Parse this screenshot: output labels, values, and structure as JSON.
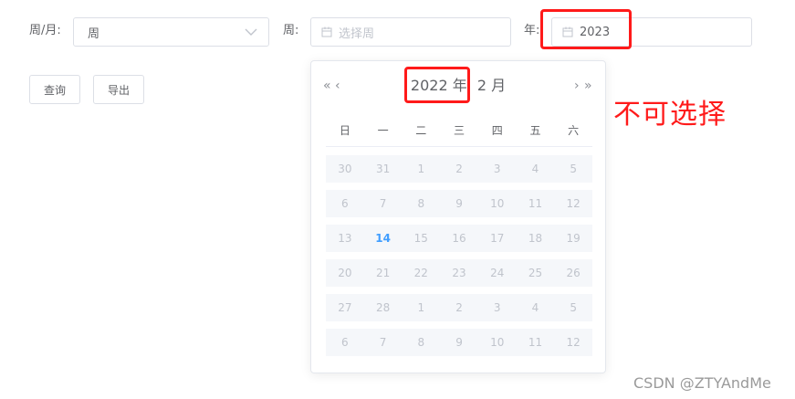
{
  "form": {
    "period_label": "周/月:",
    "period_value": "周",
    "week_label": "周:",
    "week_placeholder": "选择周",
    "year_label": "年:",
    "year_value": "2023"
  },
  "buttons": {
    "query": "查询",
    "export": "导出"
  },
  "picker": {
    "year_text": "2022 年",
    "month_text": "2 月",
    "weekdays": [
      "日",
      "一",
      "二",
      "三",
      "四",
      "五",
      "六"
    ],
    "rows": [
      [
        "30",
        "31",
        "1",
        "2",
        "3",
        "4",
        "5"
      ],
      [
        "6",
        "7",
        "8",
        "9",
        "10",
        "11",
        "12"
      ],
      [
        "13",
        "14",
        "15",
        "16",
        "17",
        "18",
        "19"
      ],
      [
        "20",
        "21",
        "22",
        "23",
        "24",
        "25",
        "26"
      ],
      [
        "27",
        "28",
        "1",
        "2",
        "3",
        "4",
        "5"
      ],
      [
        "6",
        "7",
        "8",
        "9",
        "10",
        "11",
        "12"
      ]
    ],
    "today": "14"
  },
  "annotation": "不可选择",
  "watermark": "CSDN @ZTYAndMe",
  "colors": {
    "accent": "#409eff",
    "annotation_red": "#ff1a1a",
    "disabled_text": "#c0c4cc",
    "disabled_bg": "#f5f7fa"
  },
  "icons": [
    "calendar-icon",
    "chevron-down-icon",
    "double-left-icon",
    "left-icon",
    "right-icon",
    "double-right-icon"
  ]
}
